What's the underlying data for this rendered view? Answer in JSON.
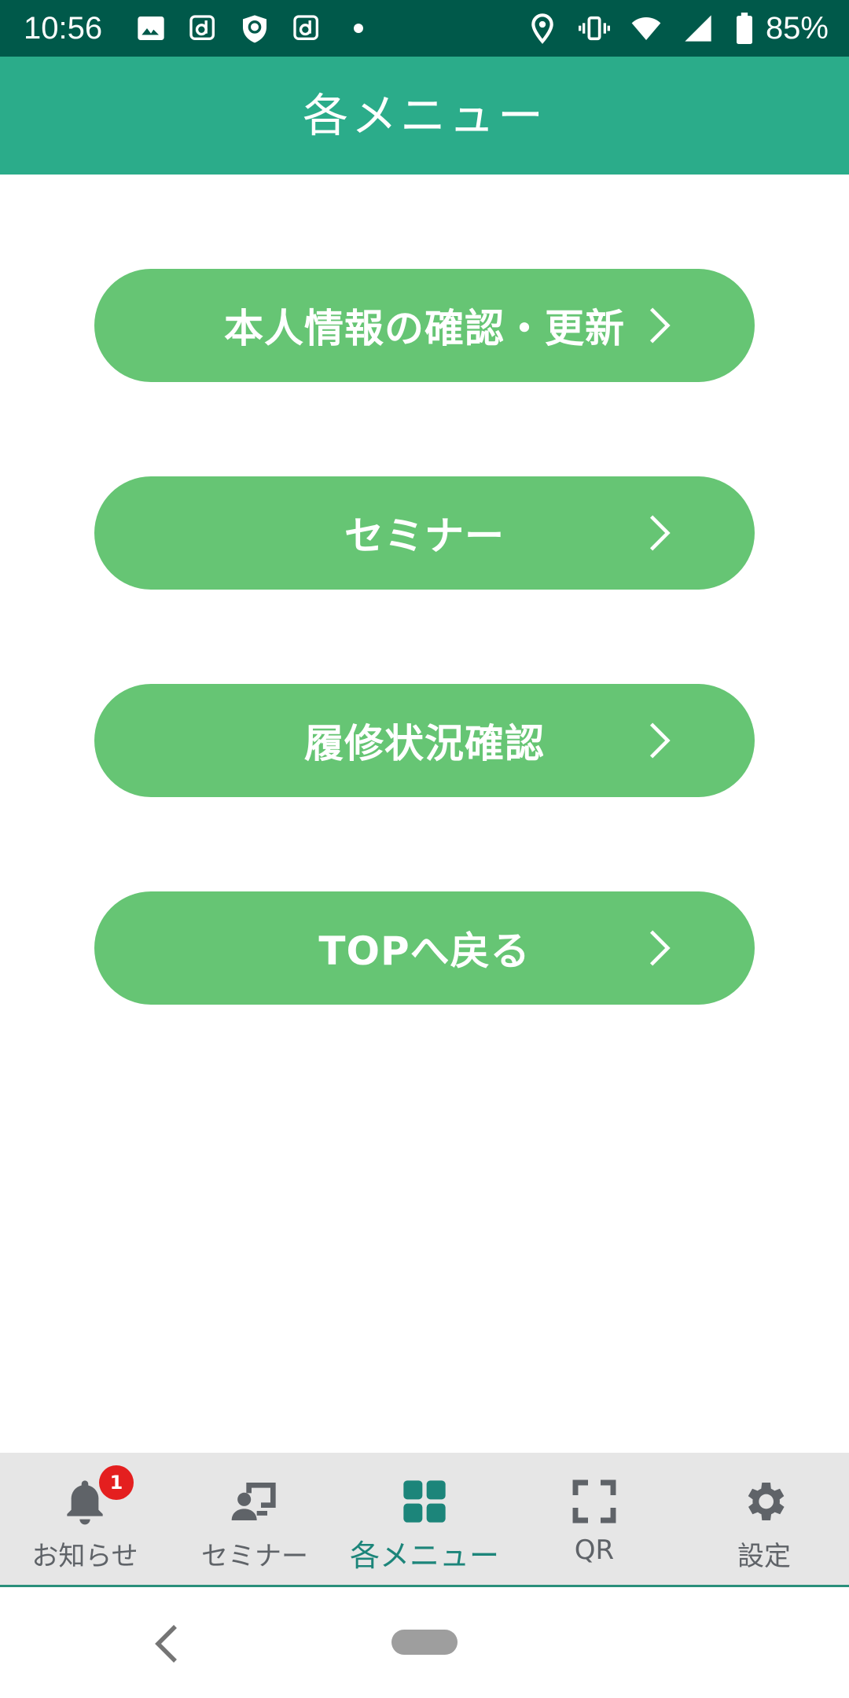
{
  "status_bar": {
    "time": "10:56",
    "battery": "85%",
    "left_icons": [
      "image-icon",
      "d-app-icon",
      "shield-icon",
      "d-app-icon",
      "notification-dot"
    ],
    "right_icons": [
      "location-icon",
      "vibrate-icon",
      "wifi-icon",
      "signal-icon",
      "battery-icon"
    ]
  },
  "header": {
    "title": "各メニュー"
  },
  "menu": {
    "items": [
      {
        "label": "本人情報の確認・更新"
      },
      {
        "label": "セミナー"
      },
      {
        "label": "履修状況確認"
      },
      {
        "label": "TOPへ戻る"
      }
    ],
    "button_color": "#66c574"
  },
  "bottom_nav": {
    "items": [
      {
        "label": "お知らせ",
        "icon": "bell-icon",
        "badge": "1"
      },
      {
        "label": "セミナー",
        "icon": "seminar-icon"
      },
      {
        "label": "各メニュー",
        "icon": "grid-icon",
        "active": true
      },
      {
        "label": "QR",
        "icon": "qr-scan-icon"
      },
      {
        "label": "設定",
        "icon": "gear-icon"
      }
    ],
    "active_color": "#1c857a"
  },
  "colors": {
    "status_bar": "#00594a",
    "header": "#2bac8a",
    "badge": "#e41f1f"
  }
}
